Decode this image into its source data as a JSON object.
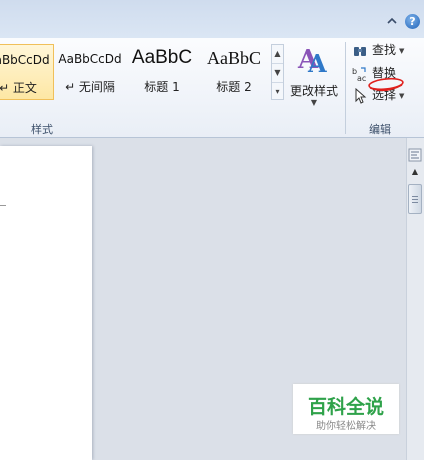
{
  "ribbon": {
    "styles_group": {
      "label": "样式",
      "tiles": [
        {
          "sample": "AaBbCcDd",
          "name": "↵ 正文",
          "selected": true
        },
        {
          "sample": "AaBbCcDd",
          "name": "↵ 无间隔",
          "selected": false
        },
        {
          "sample": "AaBbC",
          "name": "标题 1",
          "selected": false
        },
        {
          "sample": "AaBbC",
          "name": "标题 2",
          "selected": false
        }
      ],
      "change_styles_label": "更改样式",
      "scroll_up": "▲",
      "scroll_down": "▼",
      "more": "▾"
    },
    "editing_group": {
      "label": "编辑",
      "find_label": "查找",
      "replace_label": "替换",
      "select_label": "选择"
    }
  },
  "icons": {
    "collapse_ribbon": "chevron-up-icon",
    "help": "help-icon",
    "find": "binoculars-icon",
    "replace": "replace-icon",
    "select": "cursor-arrow-icon",
    "change_styles": "styles-A-icon"
  },
  "help_glyph": "?",
  "watermark": {
    "title": "百科全说",
    "subtitle": "助你轻松解决"
  },
  "colors": {
    "accent_green": "#2fa24a",
    "selected_tile": "#fde7a4",
    "annotation_red": "#e0201c"
  }
}
